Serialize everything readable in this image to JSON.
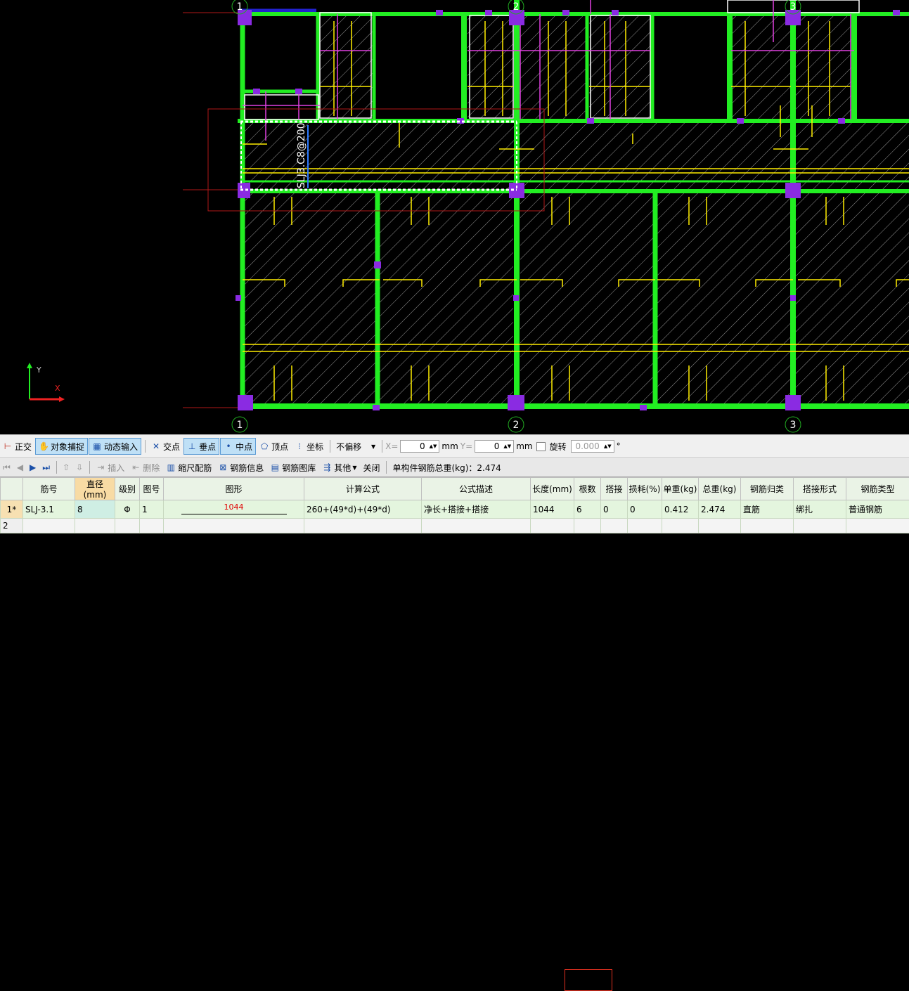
{
  "canvas": {
    "axis_labels": [
      "1",
      "2",
      "3"
    ],
    "beam_label": "SLJ3.C8@200",
    "ucs": {
      "y": "Y",
      "x": "X"
    }
  },
  "toolbar1": {
    "ortho": "正交",
    "snap": "对象捕捉",
    "dynamic_input": "动态输入",
    "intersection": "交点",
    "perpendicular": "垂点",
    "midpoint": "中点",
    "vertex": "顶点",
    "coordinate": "坐标",
    "offset_mode": "不偏移",
    "x_label": "X=",
    "x_value": "0",
    "x_unit": "mm",
    "y_label": "Y=",
    "y_value": "0",
    "y_unit": "mm",
    "rotate": "旋转",
    "rotate_value": "0.000",
    "degree": "°"
  },
  "toolbar2": {
    "insert": "插入",
    "delete": "删除",
    "scale_rebar": "缩尺配筋",
    "rebar_info": "钢筋信息",
    "rebar_library": "钢筋图库",
    "other": "其他",
    "close": "关闭",
    "total_weight": "单构件钢筋总重(kg)：2.474"
  },
  "grid": {
    "headers": [
      "筋号",
      "直径(mm)",
      "级别",
      "图号",
      "图形",
      "计算公式",
      "公式描述",
      "长度(mm)",
      "根数",
      "搭接",
      "损耗(%)",
      "单重(kg)",
      "总重(kg)",
      "钢筋归类",
      "搭接形式",
      "钢筋类型"
    ],
    "rows": [
      {
        "rownum": "1*",
        "bar_no": "SLJ-3.1",
        "diameter": "8",
        "grade": "Φ",
        "shape_no": "1",
        "shape_length": "1044",
        "formula": "260+(49*d)+(49*d)",
        "description": "净长+搭接+搭接",
        "length": "1044",
        "count": "6",
        "lap": "0",
        "loss": "0",
        "unit_weight": "0.412",
        "total_weight": "2.474",
        "category": "直筋",
        "lap_form": "绑扎",
        "rebar_type": "普通钢筋"
      },
      {
        "rownum": "2"
      }
    ]
  }
}
